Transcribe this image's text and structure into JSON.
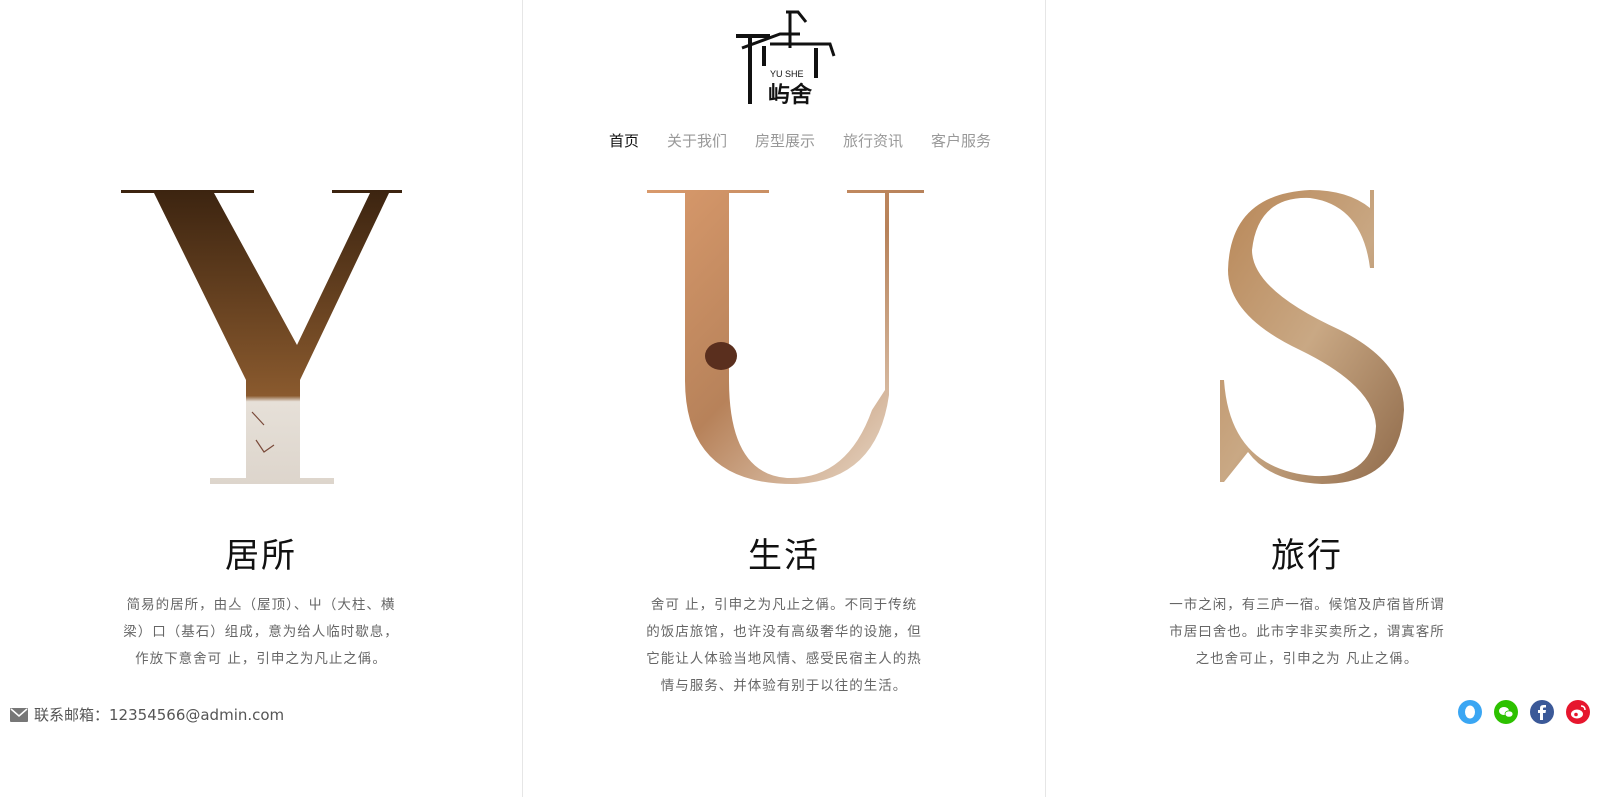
{
  "brand": {
    "logo_en": "YU SHE",
    "logo_cn": "屿舍"
  },
  "nav": {
    "items": [
      "首页",
      "关于我们",
      "房型展示",
      "旅行资讯",
      "客户服务"
    ],
    "active_index": 0
  },
  "columns": [
    {
      "letter": "Y",
      "title": "居所",
      "text": "简易的居所，由亼（屋顶）、屮（大柱、横梁）口（基石）组成，意为给人临时歇息，作放下意舍可 止，引申之为凡止之偁。"
    },
    {
      "letter": "U",
      "title": "生活",
      "text": "舍可 止，引申之为凡止之偁。不同于传统的饭店旅馆，也许没有高级奢华的设施，但它能让人体验当地风情、感受民宿主人的热情与服务、并体验有别于以往的生活。"
    },
    {
      "letter": "S",
      "title": "旅行",
      "text": "一市之闲，有三庐一宿。候馆及庐宿皆所谓市居曰舍也。此市字非买卖所之，谓寘客所之也舍可止，引申之为 凡止之偁。"
    }
  ],
  "footer": {
    "contact_label": "联系邮箱：",
    "contact_email": "12354566@admin.com",
    "social_icons": [
      "qq-icon",
      "wechat-icon",
      "facebook-icon",
      "weibo-icon"
    ]
  },
  "colors": {
    "nav_active": "#111111",
    "nav_inactive": "#999999",
    "qq": "#3aa6f3",
    "wechat": "#2dc100",
    "facebook": "#3b5998",
    "weibo": "#e6162d",
    "wood_dark": "#5b3a1f",
    "wood_light": "#c99a6e"
  }
}
